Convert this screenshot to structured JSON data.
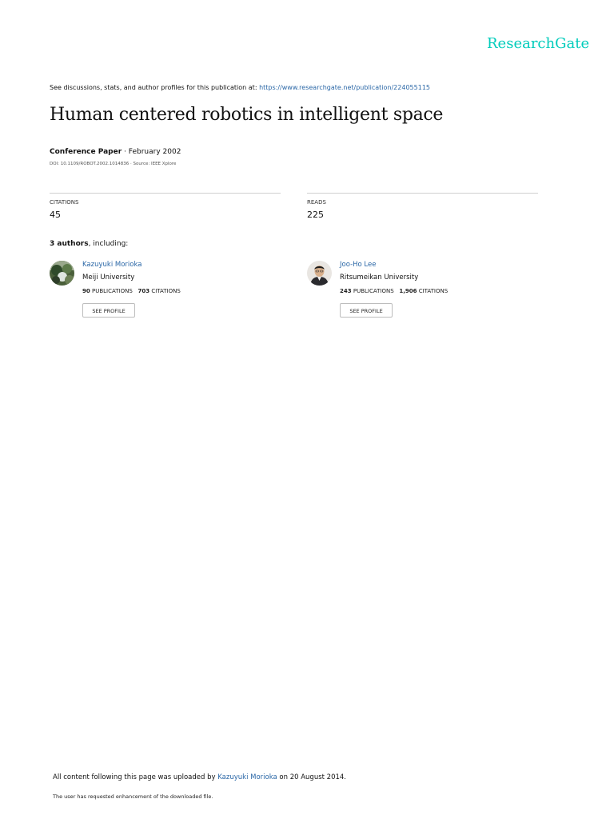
{
  "brand": {
    "logo_text": "ResearchGate",
    "color": "#00ccbb"
  },
  "discussion": {
    "prefix": "See discussions, stats, and author profiles for this publication at:",
    "url": "https://www.researchgate.net/publication/224055115"
  },
  "publication": {
    "title": "Human centered robotics in intelligent space",
    "type": "Conference Paper",
    "separator": "·",
    "date": "February 2002",
    "doi_line": "DOI: 10.1109/ROBOT.2002.1014836 · Source: IEEE Xplore"
  },
  "stats": {
    "citations_label": "CITATIONS",
    "citations_value": "45",
    "reads_label": "READS",
    "reads_value": "225"
  },
  "authors_line": {
    "count": "3 authors",
    "suffix": ", including:"
  },
  "authors": [
    {
      "name": "Kazuyuki Morioka",
      "institution": "Meiji University",
      "publications": "90",
      "publications_label": "PUBLICATIONS",
      "citations": "703",
      "citations_label": "CITATIONS",
      "button": "SEE PROFILE"
    },
    {
      "name": "Joo-Ho Lee",
      "institution": "Ritsumeikan University",
      "publications": "243",
      "publications_label": "PUBLICATIONS",
      "citations": "1,906",
      "citations_label": "CITATIONS",
      "button": "SEE PROFILE"
    }
  ],
  "footer": {
    "upload_prefix": "All content following this page was uploaded by",
    "uploader": "Kazuyuki Morioka",
    "upload_suffix": "on 20 August 2014.",
    "note": "The user has requested enhancement of the downloaded file."
  },
  "colors": {
    "link": "#2966a6",
    "rule": "#cfcfcf"
  }
}
